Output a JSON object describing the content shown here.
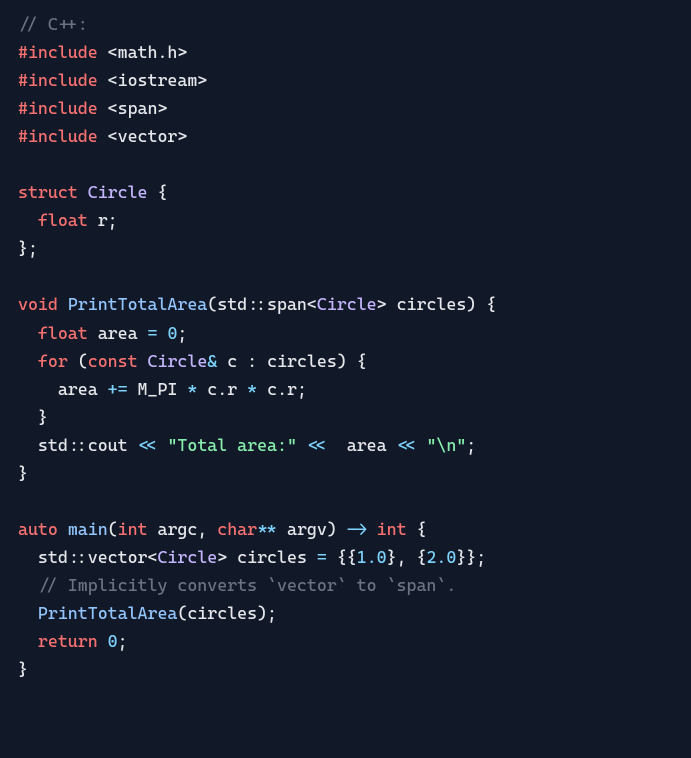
{
  "code": {
    "comment_top": "// C++:",
    "include1_macro": "#include",
    "include1_path": "<math.h>",
    "include2_macro": "#include",
    "include2_path": "<iostream>",
    "include3_macro": "#include",
    "include3_path": "<span>",
    "include4_macro": "#include",
    "include4_path": "<vector>",
    "struct_kw": "struct",
    "circle_name": "Circle",
    "open_brace": "{",
    "float_kw": "float",
    "member_r": "r",
    "semicolon": ";",
    "close_brace_semi": "};",
    "void_kw": "void",
    "print_fn": "PrintTotalArea",
    "lparen": "(",
    "std_ns": "std",
    "dblcolon": "::",
    "span_tpl": "span",
    "lt": "<",
    "gt": ">",
    "param_circles": "circles",
    "rparen": ")",
    "area_id": "area",
    "eq": "=",
    "zero": "0",
    "for_kw": "for",
    "const_kw": "const",
    "amp": "&",
    "c_id": "c",
    "colon": ":",
    "plus_eq": "+=",
    "mpi": "M_PI",
    "mul": "*",
    "dot": ".",
    "r_id": "r",
    "close_brace": "}",
    "cout_id": "cout",
    "ltlt": "<<",
    "str_total": "\"Total area:\"",
    "str_nl": "\"\\n\"",
    "auto_kw": "auto",
    "main_fn": "main",
    "int_kw": "int",
    "argc_id": "argc",
    "char_kw": "char",
    "dblstar": "**",
    "argv_id": "argv",
    "arrow": "->",
    "vector_tpl": "vector",
    "circles_id": "circles",
    "initlist": "{{",
    "one_f": "1.0",
    "comma_close_open": "}, {",
    "two_f": "2.0",
    "endinit": "}}",
    "comment_span": "// Implicitly converts `vector` to `span`.",
    "return_kw": "return",
    "ret_zero": "0"
  }
}
